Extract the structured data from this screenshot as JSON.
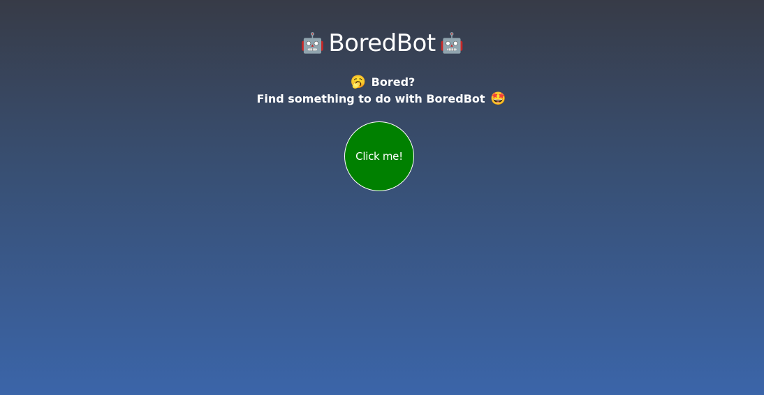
{
  "header": {
    "title": "BoredBot",
    "left_icon": "robot-face-icon",
    "right_icon": "robot-face-icon",
    "left_emoji": "🤖",
    "right_emoji": "🤖"
  },
  "tagline": {
    "line1_emoji": "🥱",
    "line1": "Bored?",
    "line2": "Find something to do with BoredBot",
    "line2_emoji": "🤩",
    "line1_icon": "yawning-face-icon",
    "line2_icon": "star-struck-icon"
  },
  "action": {
    "button_label": "Click me!",
    "button_color": "#008000"
  },
  "theme": {
    "background_top": "#373b47",
    "background_bottom": "#3b65a9",
    "text_color": "#ffffff"
  }
}
